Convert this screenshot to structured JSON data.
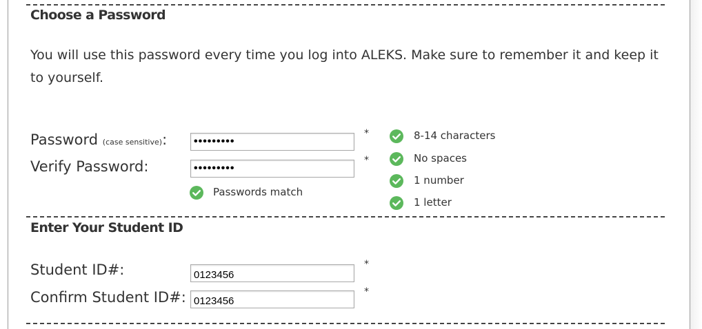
{
  "password_section": {
    "heading": "Choose a Password",
    "description": "You will use this password every time you log into ALEKS. Make sure to remember it and keep it to yourself.",
    "password_label": "Password",
    "case_sensitive_note": "(case sensitive)",
    "password_colon": ":",
    "password_value": "•••••••••",
    "verify_label": "Verify Password:",
    "verify_value": "•••••••••",
    "required_marker": "*",
    "match_message": "Passwords match",
    "requirements": [
      {
        "label": "8-14 characters",
        "met": true
      },
      {
        "label": "No spaces",
        "met": true
      },
      {
        "label": "1 number",
        "met": true
      },
      {
        "label": "1 letter",
        "met": true
      }
    ]
  },
  "student_id_section": {
    "heading": "Enter Your Student ID",
    "student_id_label": "Student ID#:",
    "student_id_value": "0123456",
    "confirm_label": "Confirm Student ID#:",
    "confirm_value": "0123456",
    "required_marker": "*"
  },
  "colors": {
    "check_green": "#5cb85c",
    "text": "#333333"
  },
  "icons": {
    "check": "check-circle-icon"
  }
}
